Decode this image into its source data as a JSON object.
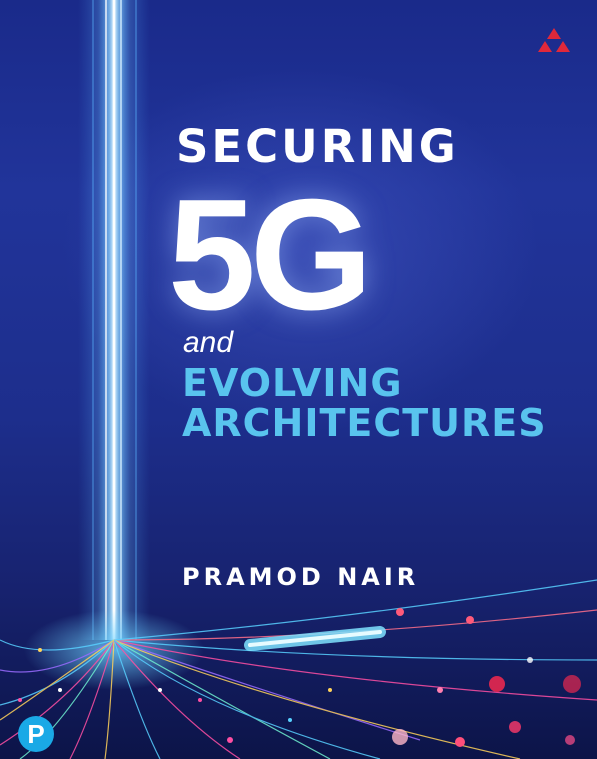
{
  "cover": {
    "title_line1": "SECURING",
    "title_line2": "5G",
    "title_line3": "and",
    "title_line4": "EVOLVING",
    "title_line5": "ARCHITECTURES",
    "author": "PRAMOD NAIR",
    "publisher_logo_letter": "P"
  },
  "icons": {
    "publisher_mark": "triangle-mark-icon",
    "pearson_logo": "pearson-logo-icon"
  },
  "colors": {
    "background_top": "#1a2a8a",
    "background_bottom": "#0c1448",
    "title_white": "#ffffff",
    "subtitle_blue": "#59c4ee",
    "mark_red": "#e0283a",
    "logo_blue": "#1aa9e6"
  }
}
